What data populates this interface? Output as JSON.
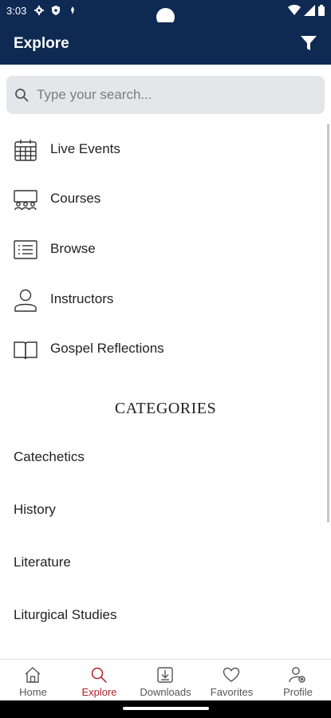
{
  "status_bar": {
    "time": "3:03"
  },
  "app_bar": {
    "title": "Explore"
  },
  "search": {
    "placeholder": "Type your search..."
  },
  "menu": [
    {
      "label": "Live Events",
      "icon": "calendar-icon"
    },
    {
      "label": "Courses",
      "icon": "classroom-icon"
    },
    {
      "label": "Browse",
      "icon": "list-icon"
    },
    {
      "label": "Instructors",
      "icon": "person-icon"
    },
    {
      "label": "Gospel Reflections",
      "icon": "book-icon"
    }
  ],
  "categories": {
    "heading": "CATEGORIES",
    "items": [
      "Catechetics",
      "History",
      "Literature",
      "Liturgical Studies"
    ]
  },
  "bottom_nav": [
    {
      "label": "Home",
      "icon": "home-icon",
      "active": false
    },
    {
      "label": "Explore",
      "icon": "search-icon",
      "active": true
    },
    {
      "label": "Downloads",
      "icon": "download-icon",
      "active": false
    },
    {
      "label": "Favorites",
      "icon": "heart-icon",
      "active": false
    },
    {
      "label": "Profile",
      "icon": "profile-settings-icon",
      "active": false
    }
  ],
  "colors": {
    "header": "#0f2a52",
    "accent": "#b01e2a",
    "search_bg": "#e5e6ea"
  }
}
